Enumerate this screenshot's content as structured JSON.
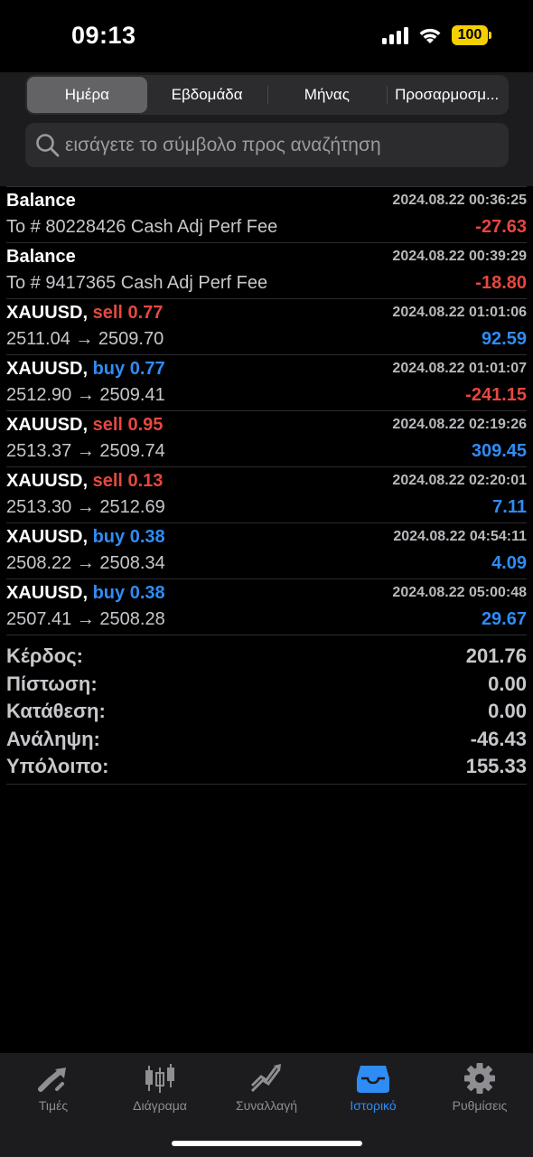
{
  "status": {
    "time": "09:13",
    "battery": "100"
  },
  "segments": [
    "Ημέρα",
    "Εβδομάδα",
    "Μήνας",
    "Προσαρμοσμ..."
  ],
  "search": {
    "placeholder": "εισάγετε το σύμβολο προς αναζήτηση"
  },
  "rows": [
    {
      "title": "Balance",
      "side": "",
      "vol": "",
      "date": "2024.08.22 00:36:25",
      "sub": "To # 80228426 Cash Adj Perf Fee",
      "value": "-27.63",
      "sign": "neg"
    },
    {
      "title": "Balance",
      "side": "",
      "vol": "",
      "date": "2024.08.22 00:39:29",
      "sub": "To # 9417365 Cash Adj Perf Fee",
      "value": "-18.80",
      "sign": "neg"
    },
    {
      "title": "XAUUSD,",
      "side": "sell",
      "vol": "0.77",
      "date": "2024.08.22 01:01:06",
      "sub": "2511.04 → 2509.70",
      "value": "92.59",
      "sign": "pos"
    },
    {
      "title": "XAUUSD,",
      "side": "buy",
      "vol": "0.77",
      "date": "2024.08.22 01:01:07",
      "sub": "2512.90 → 2509.41",
      "value": "-241.15",
      "sign": "neg"
    },
    {
      "title": "XAUUSD,",
      "side": "sell",
      "vol": "0.95",
      "date": "2024.08.22 02:19:26",
      "sub": "2513.37 → 2509.74",
      "value": "309.45",
      "sign": "pos"
    },
    {
      "title": "XAUUSD,",
      "side": "sell",
      "vol": "0.13",
      "date": "2024.08.22 02:20:01",
      "sub": "2513.30 → 2512.69",
      "value": "7.11",
      "sign": "pos"
    },
    {
      "title": "XAUUSD,",
      "side": "buy",
      "vol": "0.38",
      "date": "2024.08.22 04:54:11",
      "sub": "2508.22 → 2508.34",
      "value": "4.09",
      "sign": "pos"
    },
    {
      "title": "XAUUSD,",
      "side": "buy",
      "vol": "0.38",
      "date": "2024.08.22 05:00:48",
      "sub": "2507.41 → 2508.28",
      "value": "29.67",
      "sign": "pos"
    }
  ],
  "summary": [
    {
      "label": "Κέρδος:",
      "value": "201.76"
    },
    {
      "label": "Πίστωση:",
      "value": "0.00"
    },
    {
      "label": "Κατάθεση:",
      "value": "0.00"
    },
    {
      "label": "Ανάληψη:",
      "value": "-46.43"
    },
    {
      "label": "Υπόλοιπο:",
      "value": "155.33"
    }
  ],
  "tabs": [
    {
      "label": "Τιμές",
      "icon": "quotes-icon"
    },
    {
      "label": "Διάγραμα",
      "icon": "chart-icon"
    },
    {
      "label": "Συναλλαγή",
      "icon": "trade-icon"
    },
    {
      "label": "Ιστορικό",
      "icon": "history-icon",
      "active": true
    },
    {
      "label": "Ρυθμίσεις",
      "icon": "settings-icon"
    }
  ],
  "colors": {
    "sell": "#e5483f",
    "buy": "#2f8cf5",
    "active_tab": "#2f8cf5",
    "battery": "#f5d000"
  }
}
